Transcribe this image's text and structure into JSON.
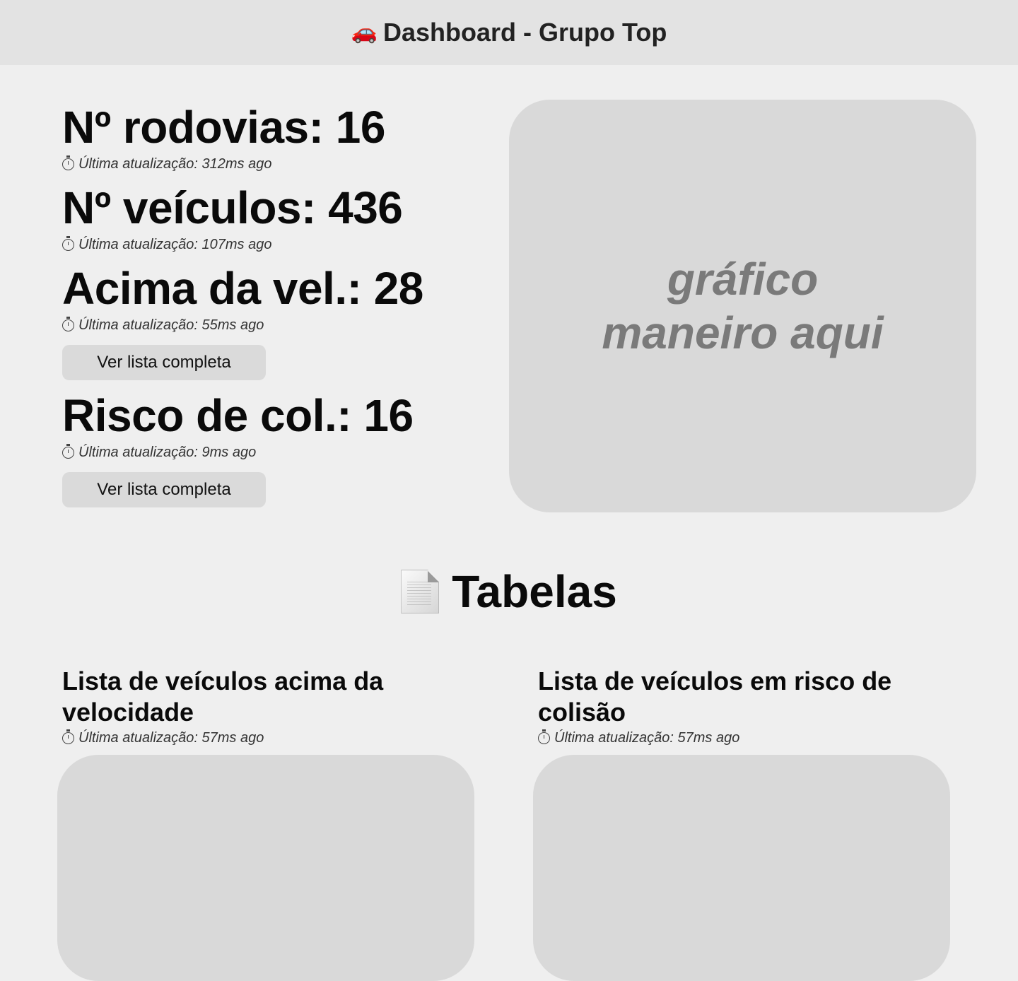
{
  "header": {
    "icon": "car-icon",
    "icon_glyph": "🚗",
    "title": "Dashboard - Grupo Top"
  },
  "stats": [
    {
      "label": "Nº rodovias: 16",
      "updated": "Última atualização: 312ms ago"
    },
    {
      "label": "Nº veículos: 436",
      "updated": "Última atualização: 107ms ago"
    },
    {
      "label": "Acima da vel.: 28",
      "updated": "Última atualização: 55ms ago",
      "button": "Ver lista completa"
    },
    {
      "label": "Risco de col.: 16",
      "updated": "Última atualização: 9ms ago",
      "button": "Ver lista completa"
    }
  ],
  "chart_placeholder": {
    "line1": "gráfico",
    "line2": "maneiro aqui"
  },
  "tables_section": {
    "icon": "document-icon",
    "title": "Tabelas"
  },
  "tables": [
    {
      "title": "Lista de veículos acima da velocidade",
      "updated": "Última atualização: 57ms ago"
    },
    {
      "title": "Lista de veículos em risco de colisão",
      "updated": "Última atualização: 57ms ago"
    }
  ],
  "colors": {
    "background": "#efefef",
    "header_bg": "#e3e3e3",
    "panel_bg": "#d9d9d9",
    "button_bg": "#dadada",
    "placeholder_text": "#7a7a7a"
  }
}
